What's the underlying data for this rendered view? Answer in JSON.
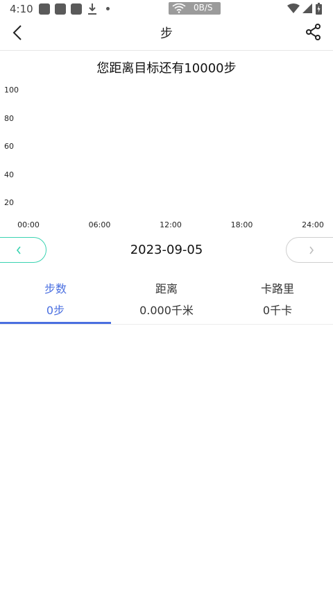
{
  "status_bar": {
    "time": "4:10",
    "network_speed": "0B/S"
  },
  "header": {
    "title": "步",
    "back_icon": "back-arrow-icon",
    "share_icon": "share-icon"
  },
  "goal_text": "您距离目标还有10000步",
  "chart_data": {
    "type": "bar",
    "categories": [
      "00:00",
      "06:00",
      "12:00",
      "18:00",
      "24:00"
    ],
    "values": [
      0,
      0,
      0,
      0,
      0
    ],
    "y_ticks": [
      "100",
      "80",
      "60",
      "40",
      "20"
    ],
    "ylim": [
      0,
      100
    ],
    "grid": false
  },
  "date_nav": {
    "date": "2023-09-05",
    "prev_icon": "chevron-left-icon",
    "next_icon": "chevron-right-icon",
    "accent_color": "#3ad3b1"
  },
  "tabs": [
    {
      "label": "步数",
      "value": "0步",
      "active": true
    },
    {
      "label": "距离",
      "value": "0.000千米",
      "active": false
    },
    {
      "label": "卡路里",
      "value": "0千卡",
      "active": false
    }
  ],
  "colors": {
    "active_tab": "#4a6fe0"
  }
}
